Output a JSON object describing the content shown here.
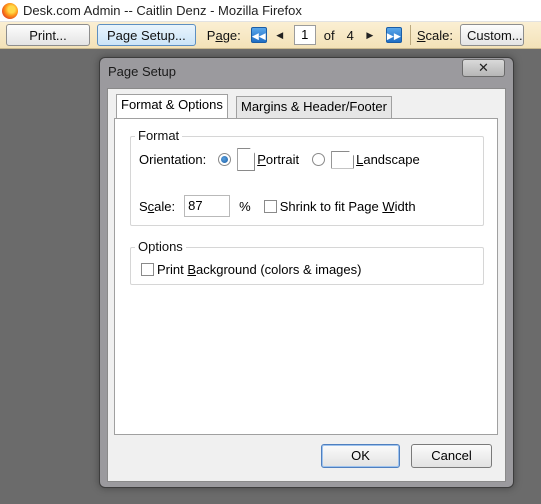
{
  "window": {
    "title": "Desk.com Admin -- Caitlin Denz - Mozilla Firefox"
  },
  "toolbar": {
    "print_label": "Print...",
    "page_setup_label": "Page Setup...",
    "page_label_pre": "P",
    "page_label_u": "a",
    "page_label_post": "ge:",
    "page_value": "1",
    "of_label": "of",
    "page_total": "4",
    "scale_label_u": "S",
    "scale_label_post": "cale:",
    "scale_value": "Custom..."
  },
  "dialog": {
    "title": "Page Setup",
    "close_glyph": "✕",
    "tabs": [
      {
        "label": "Format & Options"
      },
      {
        "label": "Margins & Header/Footer"
      }
    ],
    "format": {
      "group_title": "Format",
      "orientation_label": "Orientation:",
      "portrait_u": "P",
      "portrait_rest": "ortrait",
      "landscape_u": "L",
      "landscape_rest": "andscape",
      "scale_label_pre": "S",
      "scale_label_u": "c",
      "scale_label_post": "ale:",
      "scale_value": "87",
      "percent": "%",
      "shrink_pre": "Shrink to fit Page ",
      "shrink_u": "W",
      "shrink_post": "idth"
    },
    "options": {
      "group_title": "Options",
      "print_bg_pre": "Print ",
      "print_bg_u": "B",
      "print_bg_post": "ackground (colors & images)"
    },
    "ok_label": "OK",
    "cancel_label": "Cancel"
  }
}
